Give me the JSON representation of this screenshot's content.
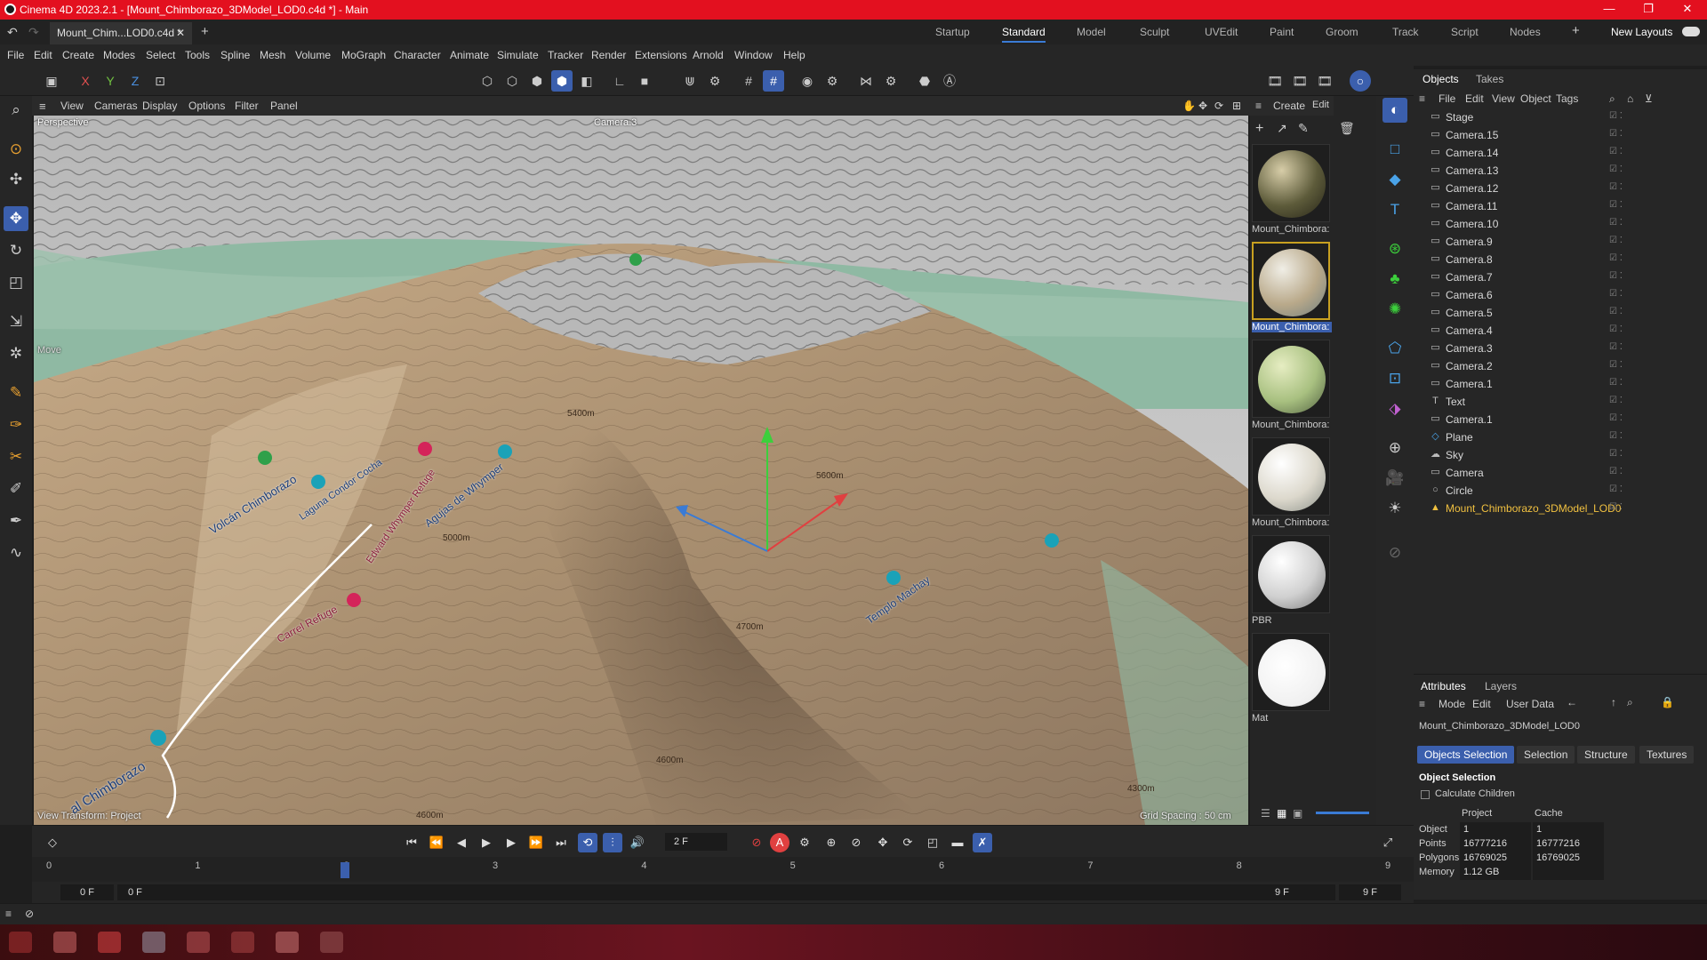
{
  "window": {
    "title": "Cinema 4D 2023.2.1 - [Mount_Chimborazo_3DModel_LOD0.c4d *] - Main",
    "minimize": "—",
    "maximize": "❐",
    "close": "✕"
  },
  "tabs": {
    "document": "Mount_Chim...LOD0.c4d *",
    "layouts": [
      "Startup",
      "Standard",
      "Model",
      "Sculpt",
      "UVEdit",
      "Paint",
      "Groom",
      "Track",
      "Script",
      "Nodes"
    ],
    "active_layout": "Standard",
    "new_layouts": "New Layouts"
  },
  "menu": [
    "File",
    "Edit",
    "Create",
    "Modes",
    "Select",
    "Tools",
    "Spline",
    "Mesh",
    "Volume",
    "MoGraph",
    "Character",
    "Animate",
    "Simulate",
    "Tracker",
    "Render",
    "Extensions",
    "Arnold",
    "Window",
    "Help"
  ],
  "toolbar": {
    "axis_x": "X",
    "axis_y": "Y",
    "axis_z": "Z"
  },
  "viewport": {
    "menu": [
      "View",
      "Cameras",
      "Display",
      "Options",
      "Filter",
      "Panel"
    ],
    "projection": "Perspective",
    "camera": "Camera.3",
    "tool_label": "Move",
    "view_transform": "View Transform: Project",
    "grid_spacing": "Grid Spacing : 50 cm",
    "map_labels": [
      "Volcán Chimborazo",
      "Laguna Condor Cocha",
      "Agujas de Whymper",
      "Edward Whymper Refuge",
      "Carrel Refuge",
      "Templo Machay",
      "al Chimborazo"
    ],
    "contour_labels": [
      "5000m",
      "5400m",
      "4700m",
      "4600m",
      "4300m",
      "4600m",
      "5600m"
    ]
  },
  "materials": {
    "menu": [
      "Create",
      "Edit"
    ],
    "items": [
      {
        "name": "Mount_Chimbora:",
        "sphere": "rock"
      },
      {
        "name": "Mount_Chimbora:",
        "sphere": "map",
        "selected": true
      },
      {
        "name": "Mount_Chimbora:",
        "sphere": "green"
      },
      {
        "name": "Mount_Chimbora:",
        "sphere": "pale"
      },
      {
        "name": "PBR",
        "sphere": "white"
      },
      {
        "name": "Mat",
        "sphere": "flat"
      }
    ]
  },
  "objects": {
    "tabs": [
      "Objects",
      "Takes"
    ],
    "menu": [
      "File",
      "Edit",
      "View",
      "Object",
      "Tags"
    ],
    "rows": [
      {
        "name": "Stage",
        "icon": "stage-icon"
      },
      {
        "name": "Camera.15",
        "icon": "camera-icon"
      },
      {
        "name": "Camera.14",
        "icon": "camera-icon"
      },
      {
        "name": "Camera.13",
        "icon": "camera-icon"
      },
      {
        "name": "Camera.12",
        "icon": "camera-icon"
      },
      {
        "name": "Camera.11",
        "icon": "camera-icon"
      },
      {
        "name": "Camera.10",
        "icon": "camera-icon"
      },
      {
        "name": "Camera.9",
        "icon": "camera-icon"
      },
      {
        "name": "Camera.8",
        "icon": "camera-icon"
      },
      {
        "name": "Camera.7",
        "icon": "camera-icon"
      },
      {
        "name": "Camera.6",
        "icon": "camera-icon"
      },
      {
        "name": "Camera.5",
        "icon": "camera-icon"
      },
      {
        "name": "Camera.4",
        "icon": "camera-icon"
      },
      {
        "name": "Camera.3",
        "icon": "camera-icon"
      },
      {
        "name": "Camera.2",
        "icon": "camera-icon"
      },
      {
        "name": "Camera.1",
        "icon": "camera-icon"
      },
      {
        "name": "Text",
        "icon": "text-icon"
      },
      {
        "name": "Camera.1",
        "icon": "camera-icon"
      },
      {
        "name": "Plane",
        "icon": "plane-icon"
      },
      {
        "name": "Sky",
        "icon": "sky-icon"
      },
      {
        "name": "Camera",
        "icon": "camera-icon"
      },
      {
        "name": "Circle",
        "icon": "circle-icon"
      },
      {
        "name": "Mount_Chimborazo_3DModel_LOD0",
        "icon": "polygon-icon",
        "highlighted": true
      }
    ]
  },
  "attributes": {
    "tabs": [
      "Attributes",
      "Layers"
    ],
    "menu": [
      "Mode",
      "Edit",
      "User Data"
    ],
    "object_name": "Mount_Chimborazo_3DModel_LOD0",
    "sub_tabs": [
      "Objects Selection",
      "Selection",
      "Structure",
      "Textures"
    ],
    "section": "Object Selection",
    "calc_children": "Calculate Children",
    "col_project": "Project",
    "col_cache": "Cache",
    "rows": [
      {
        "label": "Object",
        "project": "1",
        "cache": "1"
      },
      {
        "label": "Points",
        "project": "16777216",
        "cache": "16777216"
      },
      {
        "label": "Polygons",
        "project": "16769025",
        "cache": "16769025"
      },
      {
        "label": "Memory",
        "project": "1.12 GB",
        "cache": ""
      }
    ]
  },
  "timeline": {
    "current_frame": "2 F",
    "ticks": [
      "0",
      "1",
      "2",
      "3",
      "4",
      "5",
      "6",
      "7",
      "8",
      "9"
    ],
    "start": "0 F",
    "range_start": "0 F",
    "range_end": "9 F",
    "end": "9 F",
    "playhead_frame": 2
  },
  "colors": {
    "titlebar": "#e3101f",
    "accent": "#3b5fad",
    "highlight_object": "#f0c040"
  }
}
